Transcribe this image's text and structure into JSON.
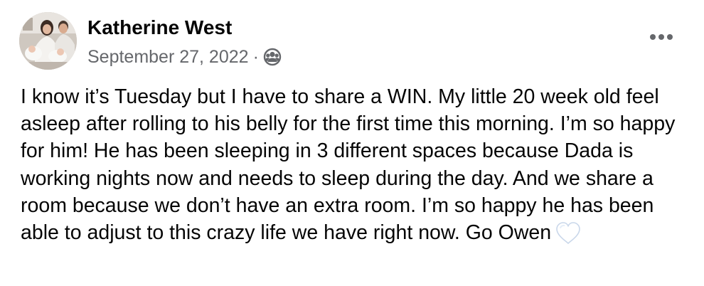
{
  "post": {
    "author": "Katherine West",
    "date": "September 27, 2022",
    "separator": "·",
    "audience_icon": "friends-icon",
    "more_icon": "more-options-icon",
    "body": "I know it’s Tuesday but I have to share a WIN. My little 20 week old feel asleep after rolling to his belly for the first time this morning. I’m so happy for him! He has been sleeping in 3 different spaces because Dada is working nights now and needs to sleep during the day. And we share a room because we don’t have an extra room. I’m so happy he has been able to adjust to this crazy life we have right now. Go Owen",
    "emoji_icon": "white-heart-icon"
  },
  "colors": {
    "text": "#050505",
    "secondary": "#65676b",
    "background": "#ffffff"
  }
}
